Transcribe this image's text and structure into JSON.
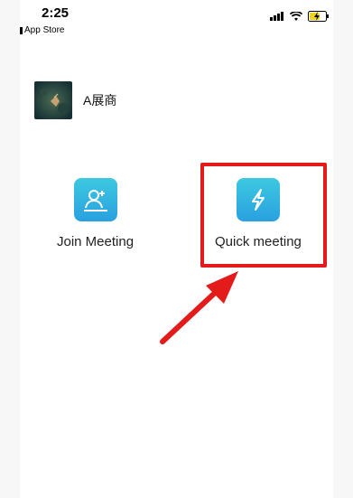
{
  "status_bar": {
    "time": "2:25",
    "back_app": "App Store"
  },
  "user": {
    "name": "A展商"
  },
  "actions": {
    "join_label": "Join Meeting",
    "quick_label": "Quick meeting"
  },
  "colors": {
    "icon_tile_top": "#3cc9e0",
    "icon_tile_bottom": "#2aa0e0",
    "highlight": "#e31b1b"
  }
}
